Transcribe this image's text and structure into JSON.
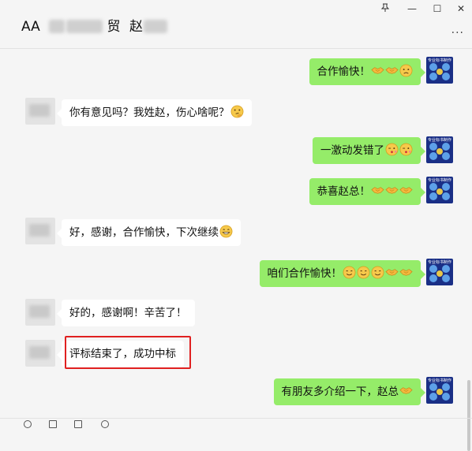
{
  "header": {
    "title_prefix": "AA",
    "title_part2": "贸",
    "title_part3": "赵",
    "pin_icon": "pin-icon",
    "minimize": "—",
    "maximize": "☐",
    "close": "✕",
    "more": "..."
  },
  "messages": [
    {
      "side": "out",
      "text": "合作愉快！",
      "emojis": [
        "handshake",
        "handshake",
        "sad-face"
      ]
    },
    {
      "side": "in",
      "text": "你有意见吗？我姓赵，伤心啥呢？",
      "emojis": [
        "thinking-face"
      ]
    },
    {
      "side": "out",
      "text": "一激动发错了",
      "emojis": [
        "wink-kiss-face",
        "wink-kiss-face"
      ]
    },
    {
      "side": "out",
      "text": "恭喜赵总！",
      "emojis": [
        "handshake",
        "handshake",
        "handshake"
      ]
    },
    {
      "side": "in",
      "text": "好，感谢，合作愉快，下次继续",
      "emojis": [
        "grin-face"
      ]
    },
    {
      "side": "out",
      "text": "咱们合作愉快！",
      "emojis": [
        "smile-face",
        "smile-face",
        "smile-face",
        "handshake",
        "handshake"
      ]
    },
    {
      "side": "in",
      "text": "好的，感谢啊！辛苦了！",
      "emojis": []
    },
    {
      "side": "in",
      "text": "评标结束了，成功中标",
      "emojis": [],
      "highlighted": true
    },
    {
      "side": "out",
      "text": "有朋友多介绍一下，赵总",
      "emojis": [
        "handshake"
      ]
    }
  ],
  "avatar_out_text": "专业标书制作",
  "colors": {
    "out_bubble": "#95ec69",
    "in_bubble": "#ffffff",
    "highlight": "#e02020",
    "avatar_out": "#1a2f86",
    "background": "#f5f5f5"
  }
}
